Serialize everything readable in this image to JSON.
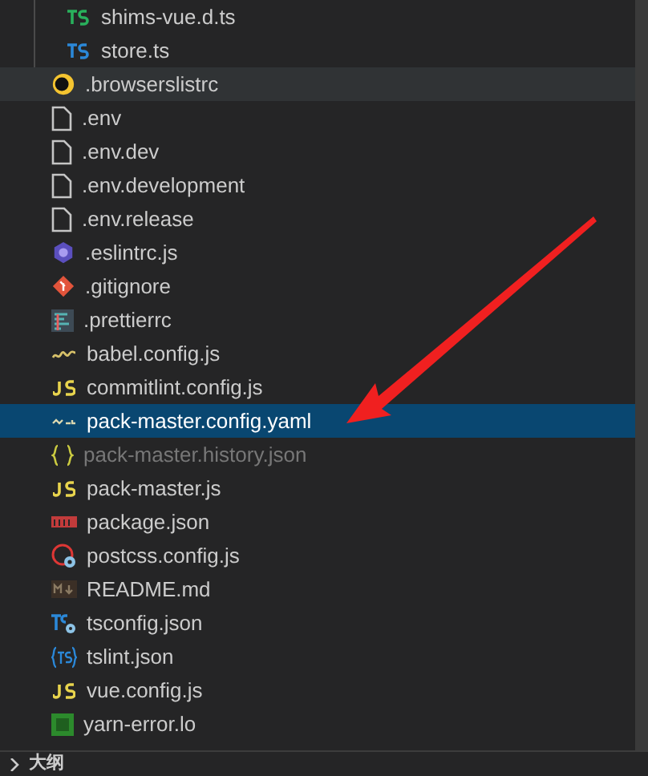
{
  "tree": {
    "continued_children": [
      {
        "name": "shims-vue.d.ts",
        "kind": "ts-green",
        "selected": false,
        "hovered": false,
        "dimmed": false
      },
      {
        "name": "store.ts",
        "kind": "ts-blue",
        "selected": false,
        "hovered": false,
        "dimmed": false
      }
    ],
    "items": [
      {
        "name": ".browserslistrc",
        "kind": "browserslist",
        "selected": false,
        "hovered": true,
        "dimmed": false
      },
      {
        "name": ".env",
        "kind": "file",
        "selected": false,
        "hovered": false,
        "dimmed": false
      },
      {
        "name": ".env.dev",
        "kind": "file",
        "selected": false,
        "hovered": false,
        "dimmed": false
      },
      {
        "name": ".env.development",
        "kind": "file",
        "selected": false,
        "hovered": false,
        "dimmed": false
      },
      {
        "name": ".env.release",
        "kind": "file",
        "selected": false,
        "hovered": false,
        "dimmed": false
      },
      {
        "name": ".eslintrc.js",
        "kind": "eslint",
        "selected": false,
        "hovered": false,
        "dimmed": false
      },
      {
        "name": ".gitignore",
        "kind": "git",
        "selected": false,
        "hovered": false,
        "dimmed": false
      },
      {
        "name": ".prettierrc",
        "kind": "prettier",
        "selected": false,
        "hovered": false,
        "dimmed": false
      },
      {
        "name": "babel.config.js",
        "kind": "babel",
        "selected": false,
        "hovered": false,
        "dimmed": false
      },
      {
        "name": "commitlint.config.js",
        "kind": "js",
        "selected": false,
        "hovered": false,
        "dimmed": false
      },
      {
        "name": "pack-master.config.yaml",
        "kind": "yaml",
        "selected": true,
        "hovered": false,
        "dimmed": false
      },
      {
        "name": "pack-master.history.json",
        "kind": "json",
        "selected": false,
        "hovered": false,
        "dimmed": true
      },
      {
        "name": "pack-master.js",
        "kind": "js",
        "selected": false,
        "hovered": false,
        "dimmed": false
      },
      {
        "name": "package.json",
        "kind": "npm",
        "selected": false,
        "hovered": false,
        "dimmed": false
      },
      {
        "name": "postcss.config.js",
        "kind": "postcss",
        "selected": false,
        "hovered": false,
        "dimmed": false
      },
      {
        "name": "README.md",
        "kind": "markdown",
        "selected": false,
        "hovered": false,
        "dimmed": false
      },
      {
        "name": "tsconfig.json",
        "kind": "tsconfig",
        "selected": false,
        "hovered": false,
        "dimmed": false
      },
      {
        "name": "tslint.json",
        "kind": "tslint",
        "selected": false,
        "hovered": false,
        "dimmed": false
      },
      {
        "name": "vue.config.js",
        "kind": "js",
        "selected": false,
        "hovered": false,
        "dimmed": false
      },
      {
        "name": "yarn-error.lo",
        "kind": "yarn",
        "selected": false,
        "hovered": false,
        "dimmed": false
      }
    ]
  },
  "outline_panel": {
    "title": "大纲",
    "expanded": false
  }
}
